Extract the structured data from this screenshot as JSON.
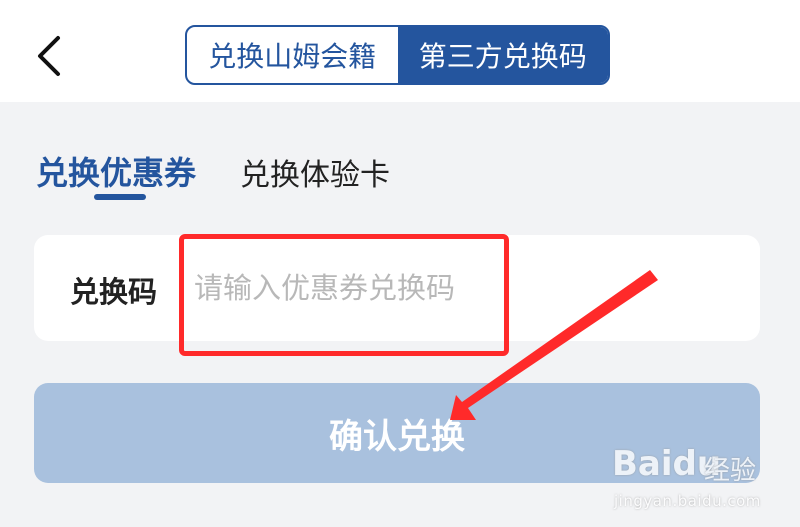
{
  "header": {
    "back_icon": "chevron-left-icon",
    "segments": [
      {
        "label": "兑换山姆会籍",
        "active": false
      },
      {
        "label": "第三方兑换码",
        "active": true
      }
    ]
  },
  "tabs": [
    {
      "label": "兑换优惠券",
      "active": true
    },
    {
      "label": "兑换体验卡",
      "active": false
    }
  ],
  "form": {
    "label": "兑换码",
    "value": "",
    "placeholder": "请输入优惠券兑换码"
  },
  "confirm": {
    "label": "确认兑换"
  },
  "watermark": {
    "logo": "Bai",
    "logo_suffix": "du",
    "text": "经验",
    "url": "jingyan.baidu.com"
  },
  "colors": {
    "accent": "#24559e",
    "button_disabled": "#a9c1de",
    "annotation": "#ff2a2a",
    "background": "#f2f3f5"
  }
}
